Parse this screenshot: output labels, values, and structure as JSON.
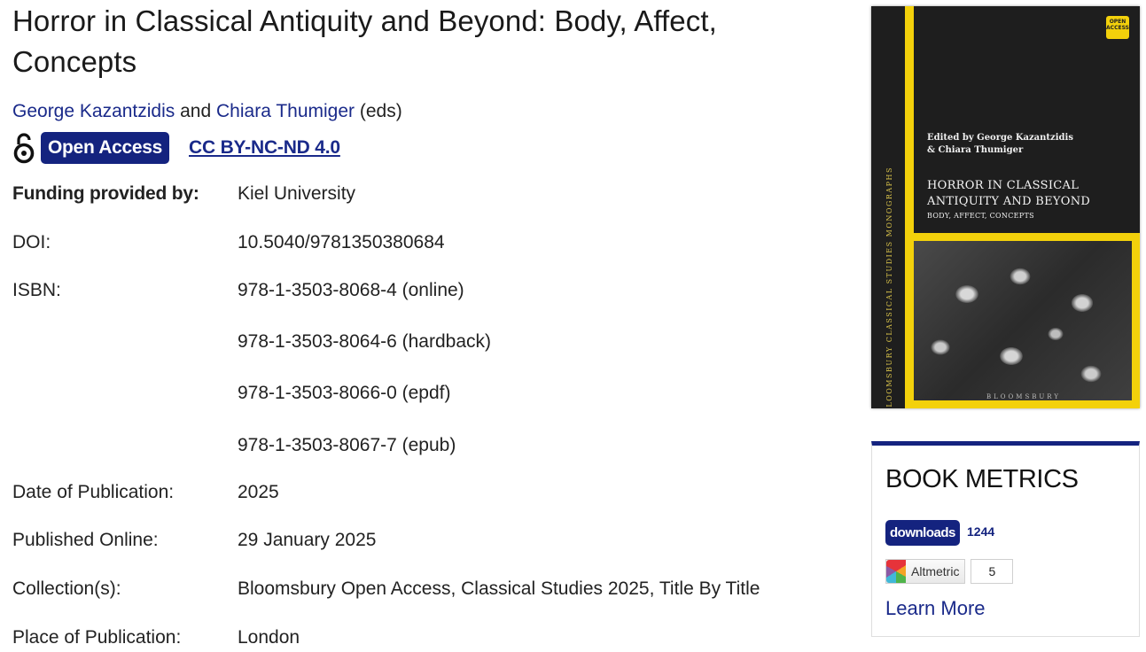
{
  "book": {
    "title": "Horror in Classical Antiquity and Beyond: Body, Affect, Concepts",
    "author1": "George Kazantzidis",
    "and_text": "and",
    "author2": "Chiara Thumiger",
    "eds_text": "(eds)",
    "oa_badge": "Open Access",
    "license": "CC BY-NC-ND 4.0"
  },
  "meta": {
    "funding_label": "Funding provided by:",
    "funding_value": "Kiel University",
    "doi_label": "DOI:",
    "doi_value": "10.5040/9781350380684",
    "isbn_label": "ISBN:",
    "isbns": [
      "978-1-3503-8068-4 (online)",
      "978-1-3503-8064-6 (hardback)",
      "978-1-3503-8066-0 (epdf)",
      "978-1-3503-8067-7 (epub)"
    ],
    "pubdate_label": "Date of Publication:",
    "pubdate_value": "2025",
    "online_label": "Published Online:",
    "online_value": "29 January 2025",
    "collection_label": "Collection(s):",
    "collection_value": "Bloomsbury Open Access, Classical Studies 2025, Title By Title",
    "place_label": "Place of Publication:",
    "place_value": "London"
  },
  "cover": {
    "editors_line1": "Edited by George Kazantzidis",
    "editors_line2": "& Chiara Thumiger",
    "title_line1": "HORROR IN CLASSICAL",
    "title_line2": "ANTIQUITY AND BEYOND",
    "subtitle": "BODY, AFFECT, CONCEPTS",
    "spine": "BLOOMSBURY CLASSICAL STUDIES MONOGRAPHS",
    "publisher": "BLOOMSBURY",
    "oa_logo": "OPEN ACCESS"
  },
  "metrics": {
    "heading": "BOOK METRICS",
    "downloads_label": "downloads",
    "downloads_count": "1244",
    "altmetric_label": "Altmetric",
    "altmetric_score": "5",
    "learn_more": "Learn More"
  },
  "colors": {
    "brand_navy": "#14237f",
    "link_blue": "#1a2a8a",
    "cover_yellow": "#f3d10b"
  }
}
